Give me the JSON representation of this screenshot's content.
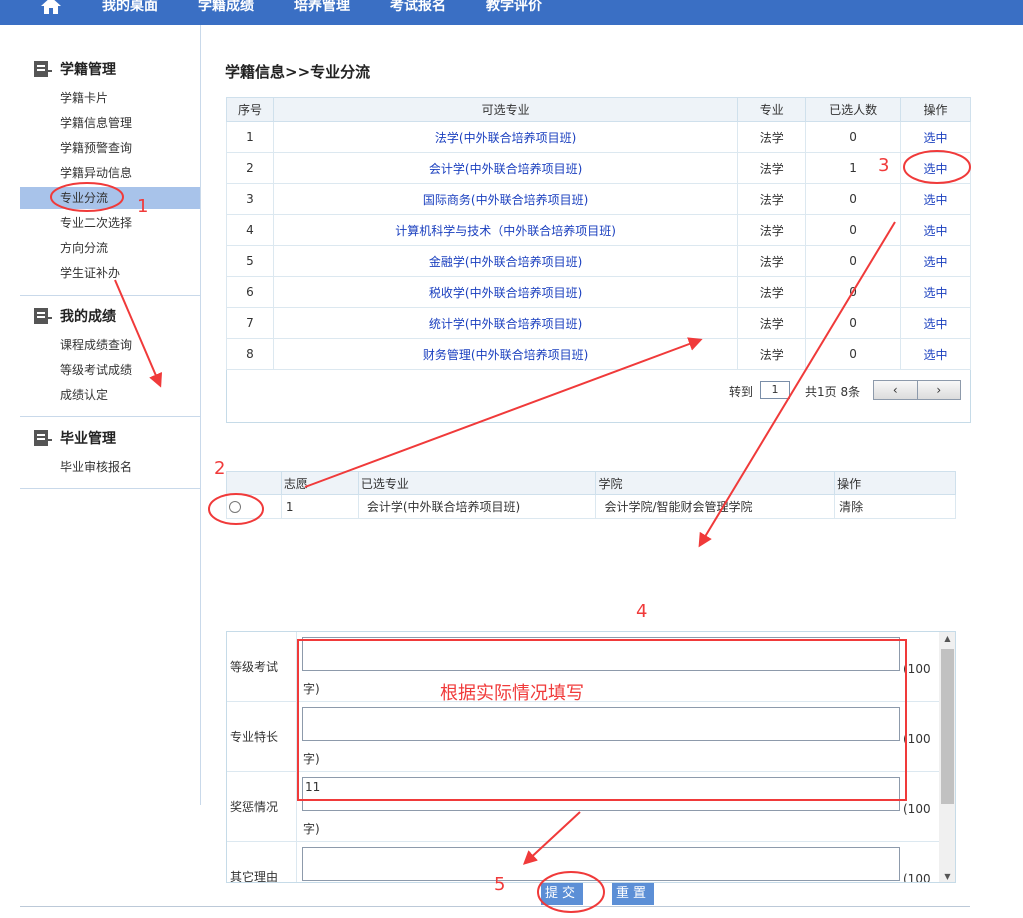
{
  "topnav": {
    "items": [
      "我的桌面",
      "学籍成绩",
      "培养管理",
      "考试报名",
      "教学评价"
    ]
  },
  "sidebar": {
    "sections": [
      {
        "title": "学籍管理",
        "items": [
          "学籍卡片",
          "学籍信息管理",
          "学籍预警查询",
          "学籍异动信息",
          "专业分流",
          "专业二次选择",
          "方向分流",
          "学生证补办"
        ]
      },
      {
        "title": "我的成绩",
        "items": [
          "课程成绩查询",
          "等级考试成绩",
          "成绩认定"
        ]
      },
      {
        "title": "毕业管理",
        "items": [
          "毕业审核报名"
        ]
      }
    ],
    "active_item": "专业分流"
  },
  "page": {
    "title": "学籍信息>>专业分流"
  },
  "majors_table": {
    "headers": [
      "序号",
      "可选专业",
      "专业",
      "已选人数",
      "操作"
    ],
    "rows": [
      {
        "no": "1",
        "major": "法学(中外联合培养项目班)",
        "category": "法学",
        "count": "0",
        "action": "选中"
      },
      {
        "no": "2",
        "major": "会计学(中外联合培养项目班)",
        "category": "法学",
        "count": "1",
        "action": "选中"
      },
      {
        "no": "3",
        "major": "国际商务(中外联合培养项目班)",
        "category": "法学",
        "count": "0",
        "action": "选中"
      },
      {
        "no": "4",
        "major": "计算机科学与技术（中外联合培养项目班)",
        "category": "法学",
        "count": "0",
        "action": "选中"
      },
      {
        "no": "5",
        "major": "金融学(中外联合培养项目班)",
        "category": "法学",
        "count": "0",
        "action": "选中"
      },
      {
        "no": "6",
        "major": "税收学(中外联合培养项目班)",
        "category": "法学",
        "count": "0",
        "action": "选中"
      },
      {
        "no": "7",
        "major": "统计学(中外联合培养项目班)",
        "category": "法学",
        "count": "0",
        "action": "选中"
      },
      {
        "no": "8",
        "major": "财务管理(中外联合培养项目班)",
        "category": "法学",
        "count": "0",
        "action": "选中"
      }
    ]
  },
  "pager": {
    "goto_label": "转到",
    "page_value": "1",
    "summary": "共1页 8条",
    "prev": "‹",
    "next": "›"
  },
  "selected_table": {
    "headers": [
      "",
      "志愿",
      "已选专业",
      "学院",
      "操作"
    ],
    "rows": [
      {
        "wish": "1",
        "major": "会计学(中外联合培养项目班)",
        "college": "会计学院/智能财会管理学院",
        "action": "清除"
      }
    ]
  },
  "form": {
    "rows": [
      {
        "label": "等级考试",
        "value": "",
        "limit": "(100",
        "limit2": "字)"
      },
      {
        "label": "专业特长",
        "value": "",
        "limit": "(100",
        "limit2": "字)"
      },
      {
        "label": "奖惩情况",
        "value": "11",
        "limit": "(100",
        "limit2": "字)"
      },
      {
        "label": "其它理由",
        "value": "",
        "limit": "(100",
        "limit2": ""
      }
    ]
  },
  "buttons": {
    "submit": "提交",
    "reset": "重置"
  },
  "annotations": {
    "n1": "1",
    "n2": "2",
    "n3": "3",
    "n4": "4",
    "n5": "5",
    "note": "根据实际情况填写",
    "color": "#f03a3a"
  }
}
